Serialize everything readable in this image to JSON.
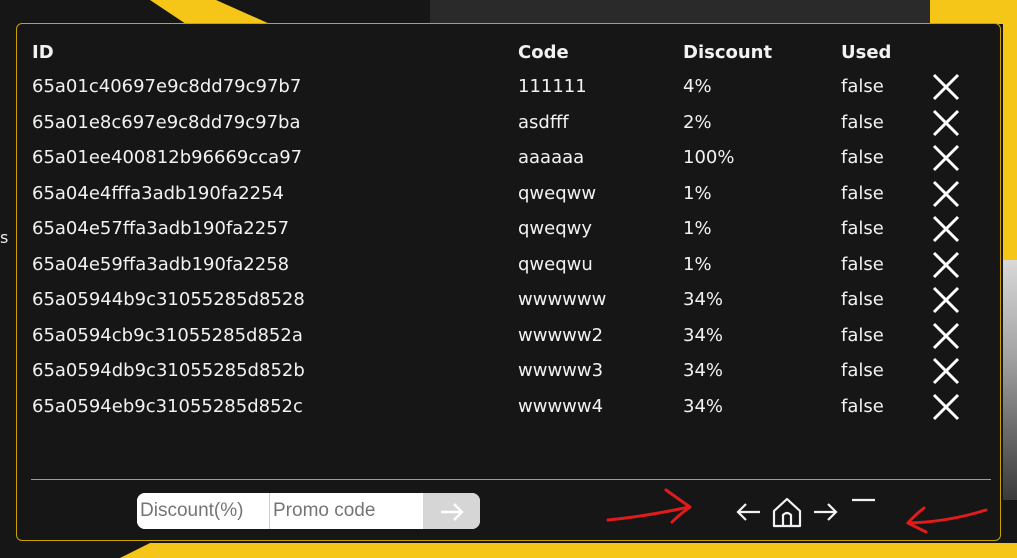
{
  "background": {
    "left_text": "s"
  },
  "table": {
    "headers": {
      "id": "ID",
      "code": "Code",
      "discount": "Discount",
      "used": "Used"
    },
    "rows": [
      {
        "id": "65a01c40697e9c8dd79c97b7",
        "code": "111111",
        "discount": "4%",
        "used": "false"
      },
      {
        "id": "65a01e8c697e9c8dd79c97ba",
        "code": "asdfff",
        "discount": "2%",
        "used": "false"
      },
      {
        "id": "65a01ee400812b96669cca97",
        "code": "aaaaaa",
        "discount": "100%",
        "used": "false"
      },
      {
        "id": "65a04e4fffa3adb190fa2254",
        "code": "qweqww",
        "discount": "1%",
        "used": "false"
      },
      {
        "id": "65a04e57ffa3adb190fa2257",
        "code": "qweqwy",
        "discount": "1%",
        "used": "false"
      },
      {
        "id": "65a04e59ffa3adb190fa2258",
        "code": "qweqwu",
        "discount": "1%",
        "used": "false"
      },
      {
        "id": "65a05944b9c31055285d8528",
        "code": "wwwwww",
        "discount": "34%",
        "used": "false"
      },
      {
        "id": "65a0594cb9c31055285d852a",
        "code": "wwwww2",
        "discount": "34%",
        "used": "false"
      },
      {
        "id": "65a0594db9c31055285d852b",
        "code": "wwwww3",
        "discount": "34%",
        "used": "false"
      },
      {
        "id": "65a0594eb9c31055285d852c",
        "code": "wwwww4",
        "discount": "34%",
        "used": "false"
      }
    ]
  },
  "form": {
    "discount_placeholder": "Discount(%)",
    "code_placeholder": "Promo code",
    "discount_value": "",
    "code_value": "",
    "submit_icon": "arrow-right-icon"
  },
  "pagination": {
    "prev_icon": "arrow-left-icon",
    "home_icon": "home-icon",
    "next_icon": "arrow-right-icon",
    "page_indicator_icon": "dash-icon"
  },
  "colors": {
    "background": "#161616",
    "accent": "#f5c518",
    "border": "#c9a200",
    "text": "#f2f2f2",
    "annotation": "#e01b1b"
  }
}
